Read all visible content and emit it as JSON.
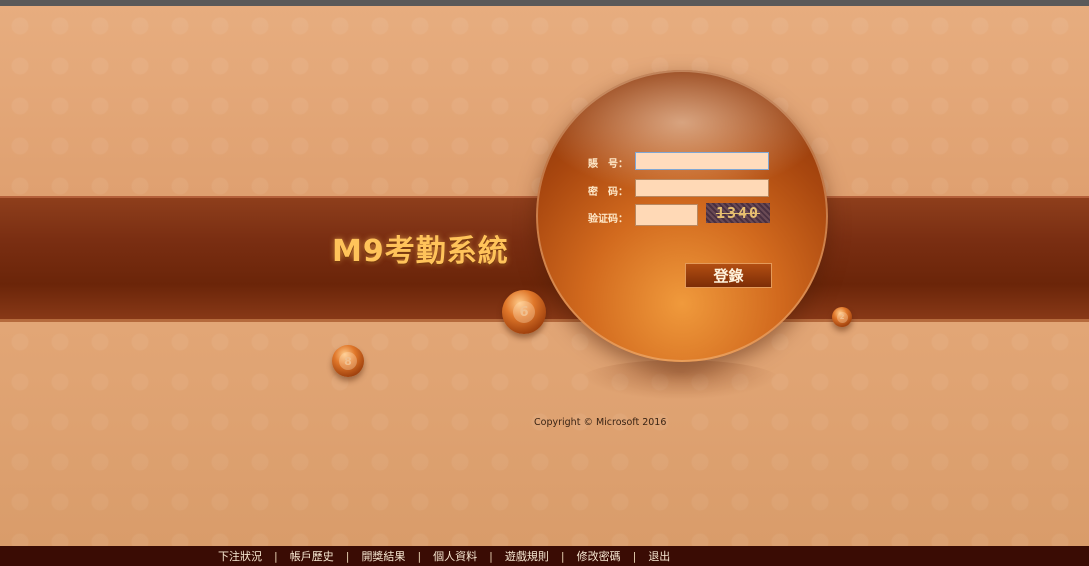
{
  "brand": {
    "title": "M9考勤系統"
  },
  "login": {
    "account_label": "賬　号：",
    "password_label": "密　码：",
    "captcha_label": "验证码：",
    "account_value": "",
    "password_value": "",
    "captcha_value": "",
    "captcha_image_text": "1340",
    "submit_label": "登錄"
  },
  "balls": [
    "6",
    "8",
    "2"
  ],
  "copyright": "Copyright © Microsoft 2016",
  "footer": {
    "links": [
      "下注狀況",
      "帳戶歷史",
      "開獎結果",
      "個人資料",
      "遊戲規則",
      "修改密碼",
      "退出"
    ],
    "separator": "|"
  },
  "colors": {
    "band": "#7a2e12",
    "background": "#dfa373",
    "footer": "#3a0c04",
    "brand": "#ffc35a"
  }
}
